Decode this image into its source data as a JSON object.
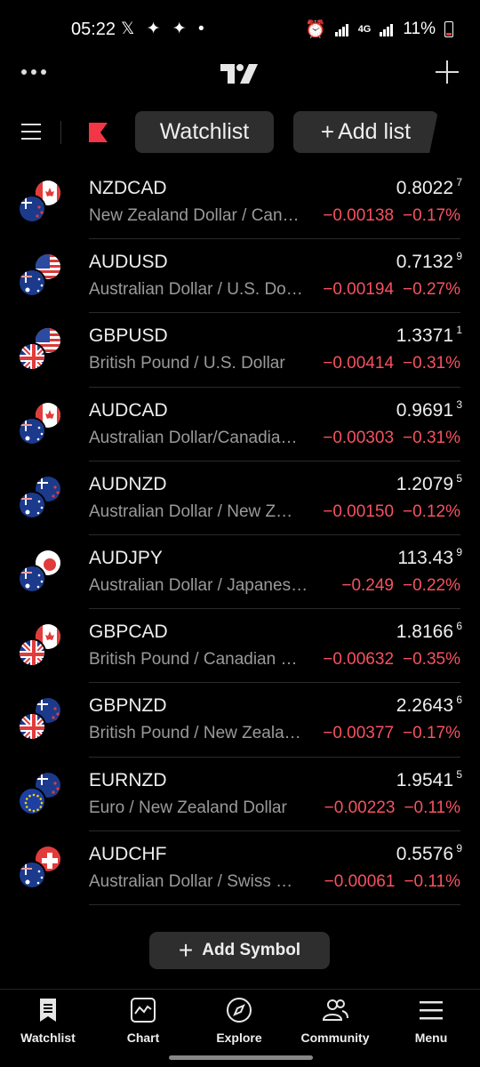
{
  "status": {
    "time": "05:22",
    "left_icons": "𝕏 ✦ ✦ •",
    "network": "4G",
    "battery": "11%"
  },
  "toolbar": {
    "watchlist_label": "Watchlist",
    "add_list_label": "Add list"
  },
  "rows": [
    {
      "symbol": "NZDCAD",
      "name": "New Zealand Dollar / Can…",
      "price": "0.8022",
      "price_sup": "7",
      "change": "−0.00138",
      "change_pct": "−0.17%",
      "flags": [
        "nz-flag",
        "ca-flag"
      ]
    },
    {
      "symbol": "AUDUSD",
      "name": "Australian Dollar / U.S. Do…",
      "price": "0.7132",
      "price_sup": "9",
      "change": "−0.00194",
      "change_pct": "−0.27%",
      "flags": [
        "au-flag",
        "us-flag"
      ]
    },
    {
      "symbol": "GBPUSD",
      "name": "British Pound / U.S. Dollar",
      "price": "1.3371",
      "price_sup": "1",
      "change": "−0.00414",
      "change_pct": "−0.31%",
      "flags": [
        "gb-flag",
        "us-flag"
      ]
    },
    {
      "symbol": "AUDCAD",
      "name": "Australian Dollar/Canadia…",
      "price": "0.9691",
      "price_sup": "3",
      "change": "−0.00303",
      "change_pct": "−0.31%",
      "flags": [
        "au-flag",
        "ca-flag"
      ]
    },
    {
      "symbol": "AUDNZD",
      "name": "Australian Dollar / New Z…",
      "price": "1.2079",
      "price_sup": "5",
      "change": "−0.00150",
      "change_pct": "−0.12%",
      "flags": [
        "au-flag",
        "nz-flag"
      ]
    },
    {
      "symbol": "AUDJPY",
      "name": "Australian Dollar / Japanese…",
      "price": "113.43",
      "price_sup": "9",
      "change": "−0.249",
      "change_pct": "−0.22%",
      "flags": [
        "au-flag",
        "jp-flag"
      ]
    },
    {
      "symbol": "GBPCAD",
      "name": "British Pound / Canadian …",
      "price": "1.8166",
      "price_sup": "6",
      "change": "−0.00632",
      "change_pct": "−0.35%",
      "flags": [
        "gb-flag",
        "ca-flag"
      ]
    },
    {
      "symbol": "GBPNZD",
      "name": "British Pound / New Zeala…",
      "price": "2.2643",
      "price_sup": "6",
      "change": "−0.00377",
      "change_pct": "−0.17%",
      "flags": [
        "gb-flag",
        "nz-flag"
      ]
    },
    {
      "symbol": "EURNZD",
      "name": "Euro / New Zealand Dollar",
      "price": "1.9541",
      "price_sup": "5",
      "change": "−0.00223",
      "change_pct": "−0.11%",
      "flags": [
        "eu-flag",
        "nz-flag"
      ]
    },
    {
      "symbol": "AUDCHF",
      "name": "Australian Dollar / Swiss …",
      "price": "0.5576",
      "price_sup": "9",
      "change": "−0.00061",
      "change_pct": "−0.11%",
      "flags": [
        "au-flag",
        "ch-flag"
      ]
    }
  ],
  "add_symbol_label": "Add Symbol",
  "nav": [
    {
      "label": "Watchlist",
      "icon": "bookmark-icon"
    },
    {
      "label": "Chart",
      "icon": "chart-icon"
    },
    {
      "label": "Explore",
      "icon": "compass-icon"
    },
    {
      "label": "Community",
      "icon": "people-icon"
    },
    {
      "label": "Menu",
      "icon": "hamburger-icon"
    }
  ],
  "colors": {
    "negative": "#f7525f",
    "chip_bg": "#2e2e2e",
    "muted_text": "#9a9a9a",
    "accent_red": "#f23645"
  }
}
